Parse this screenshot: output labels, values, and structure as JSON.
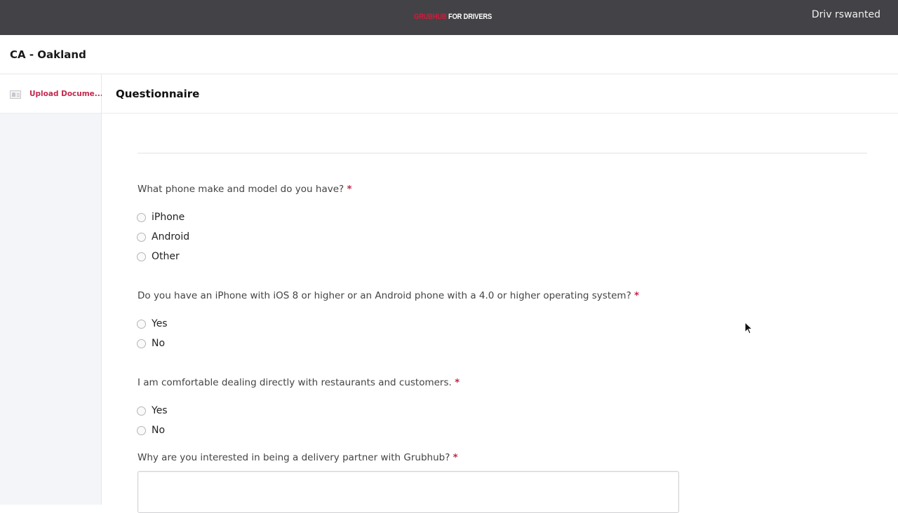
{
  "topbar": {
    "brand_red": "GRUBHUB",
    "brand_white": " FOR DRIVERS",
    "user_name": "Driv rswanted"
  },
  "subheader": {
    "city": "CA - Oakland"
  },
  "sidebar": {
    "items": [
      {
        "icon": "id-card-icon",
        "label": "Upload Docume...",
        "color": "#c5284d"
      }
    ]
  },
  "main": {
    "title": "Questionnaire",
    "questions": [
      {
        "label": "What phone make and model do you have?",
        "required": "*",
        "options": [
          "iPhone",
          "Android",
          "Other"
        ]
      },
      {
        "label": "Do you have an iPhone with iOS 8 or higher or an Android phone with a 4.0 or higher operating system?",
        "required": "*",
        "options": [
          "Yes",
          "No"
        ]
      },
      {
        "label": "I am comfortable dealing directly with restaurants and customers.",
        "required": "*",
        "options": [
          "Yes",
          "No"
        ]
      },
      {
        "label": "Why are you interested in being a delivery partner with Grubhub?",
        "required": "*",
        "value": ""
      }
    ]
  },
  "colors": {
    "topbar": "#434347",
    "accent": "#c5284d",
    "sidebar_bg": "#f4f5f9"
  }
}
